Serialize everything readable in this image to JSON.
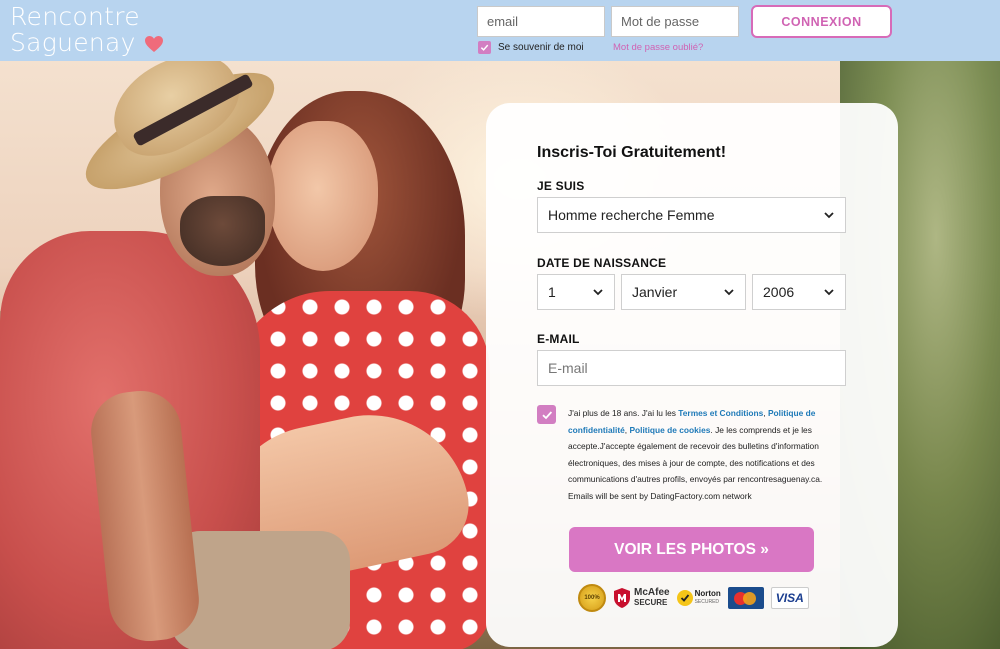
{
  "brand": {
    "line1": "Rencontre",
    "line2": "Saguenay",
    "heart_color": "#ef6b7b"
  },
  "header": {
    "email_placeholder": "email",
    "password_placeholder": "Mot de passe",
    "login_button": "CONNEXION",
    "remember_label": "Se souvenir de moi",
    "forgot_link": "Mot de passe oublié?"
  },
  "form": {
    "title": "Inscris-Toi Gratuitement!",
    "gender_label": "JE SUIS",
    "gender_value": "Homme recherche Femme",
    "dob_label": "DATE DE NAISSANCE",
    "dob_day": "1",
    "dob_month": "Janvier",
    "dob_year": "2006",
    "email_label": "E-MAIL",
    "email_placeholder": "E-mail",
    "terms_prefix": "J'ai plus de 18 ans. J'ai lu les ",
    "terms_link": "Termes et Conditions",
    "terms_sep1": ", ",
    "privacy_link": "Politique de confidentialité",
    "terms_sep2": ", ",
    "cookies_link": "Politique de cookies",
    "terms_suffix": ". Je les comprends et je les accepte.J'accepte également de recevoir des bulletins d'information électroniques, des mises à jour de compte, des notifications et des communications d'autres profils, envoyés par rencontresaguenay.ca. Emails will be sent by DatingFactory.com network",
    "cta": "VOIR LES PHOTOS »"
  },
  "badges": {
    "gold": "100%",
    "mcafee_name": "McAfee",
    "mcafee_sub": "SECURE",
    "norton_name": "Norton",
    "norton_sub": "SECURED",
    "visa": "VISA"
  },
  "colors": {
    "header_bg": "#b8d4ef",
    "accent_pink": "#d977c4",
    "link_blue": "#1f7ab8"
  }
}
